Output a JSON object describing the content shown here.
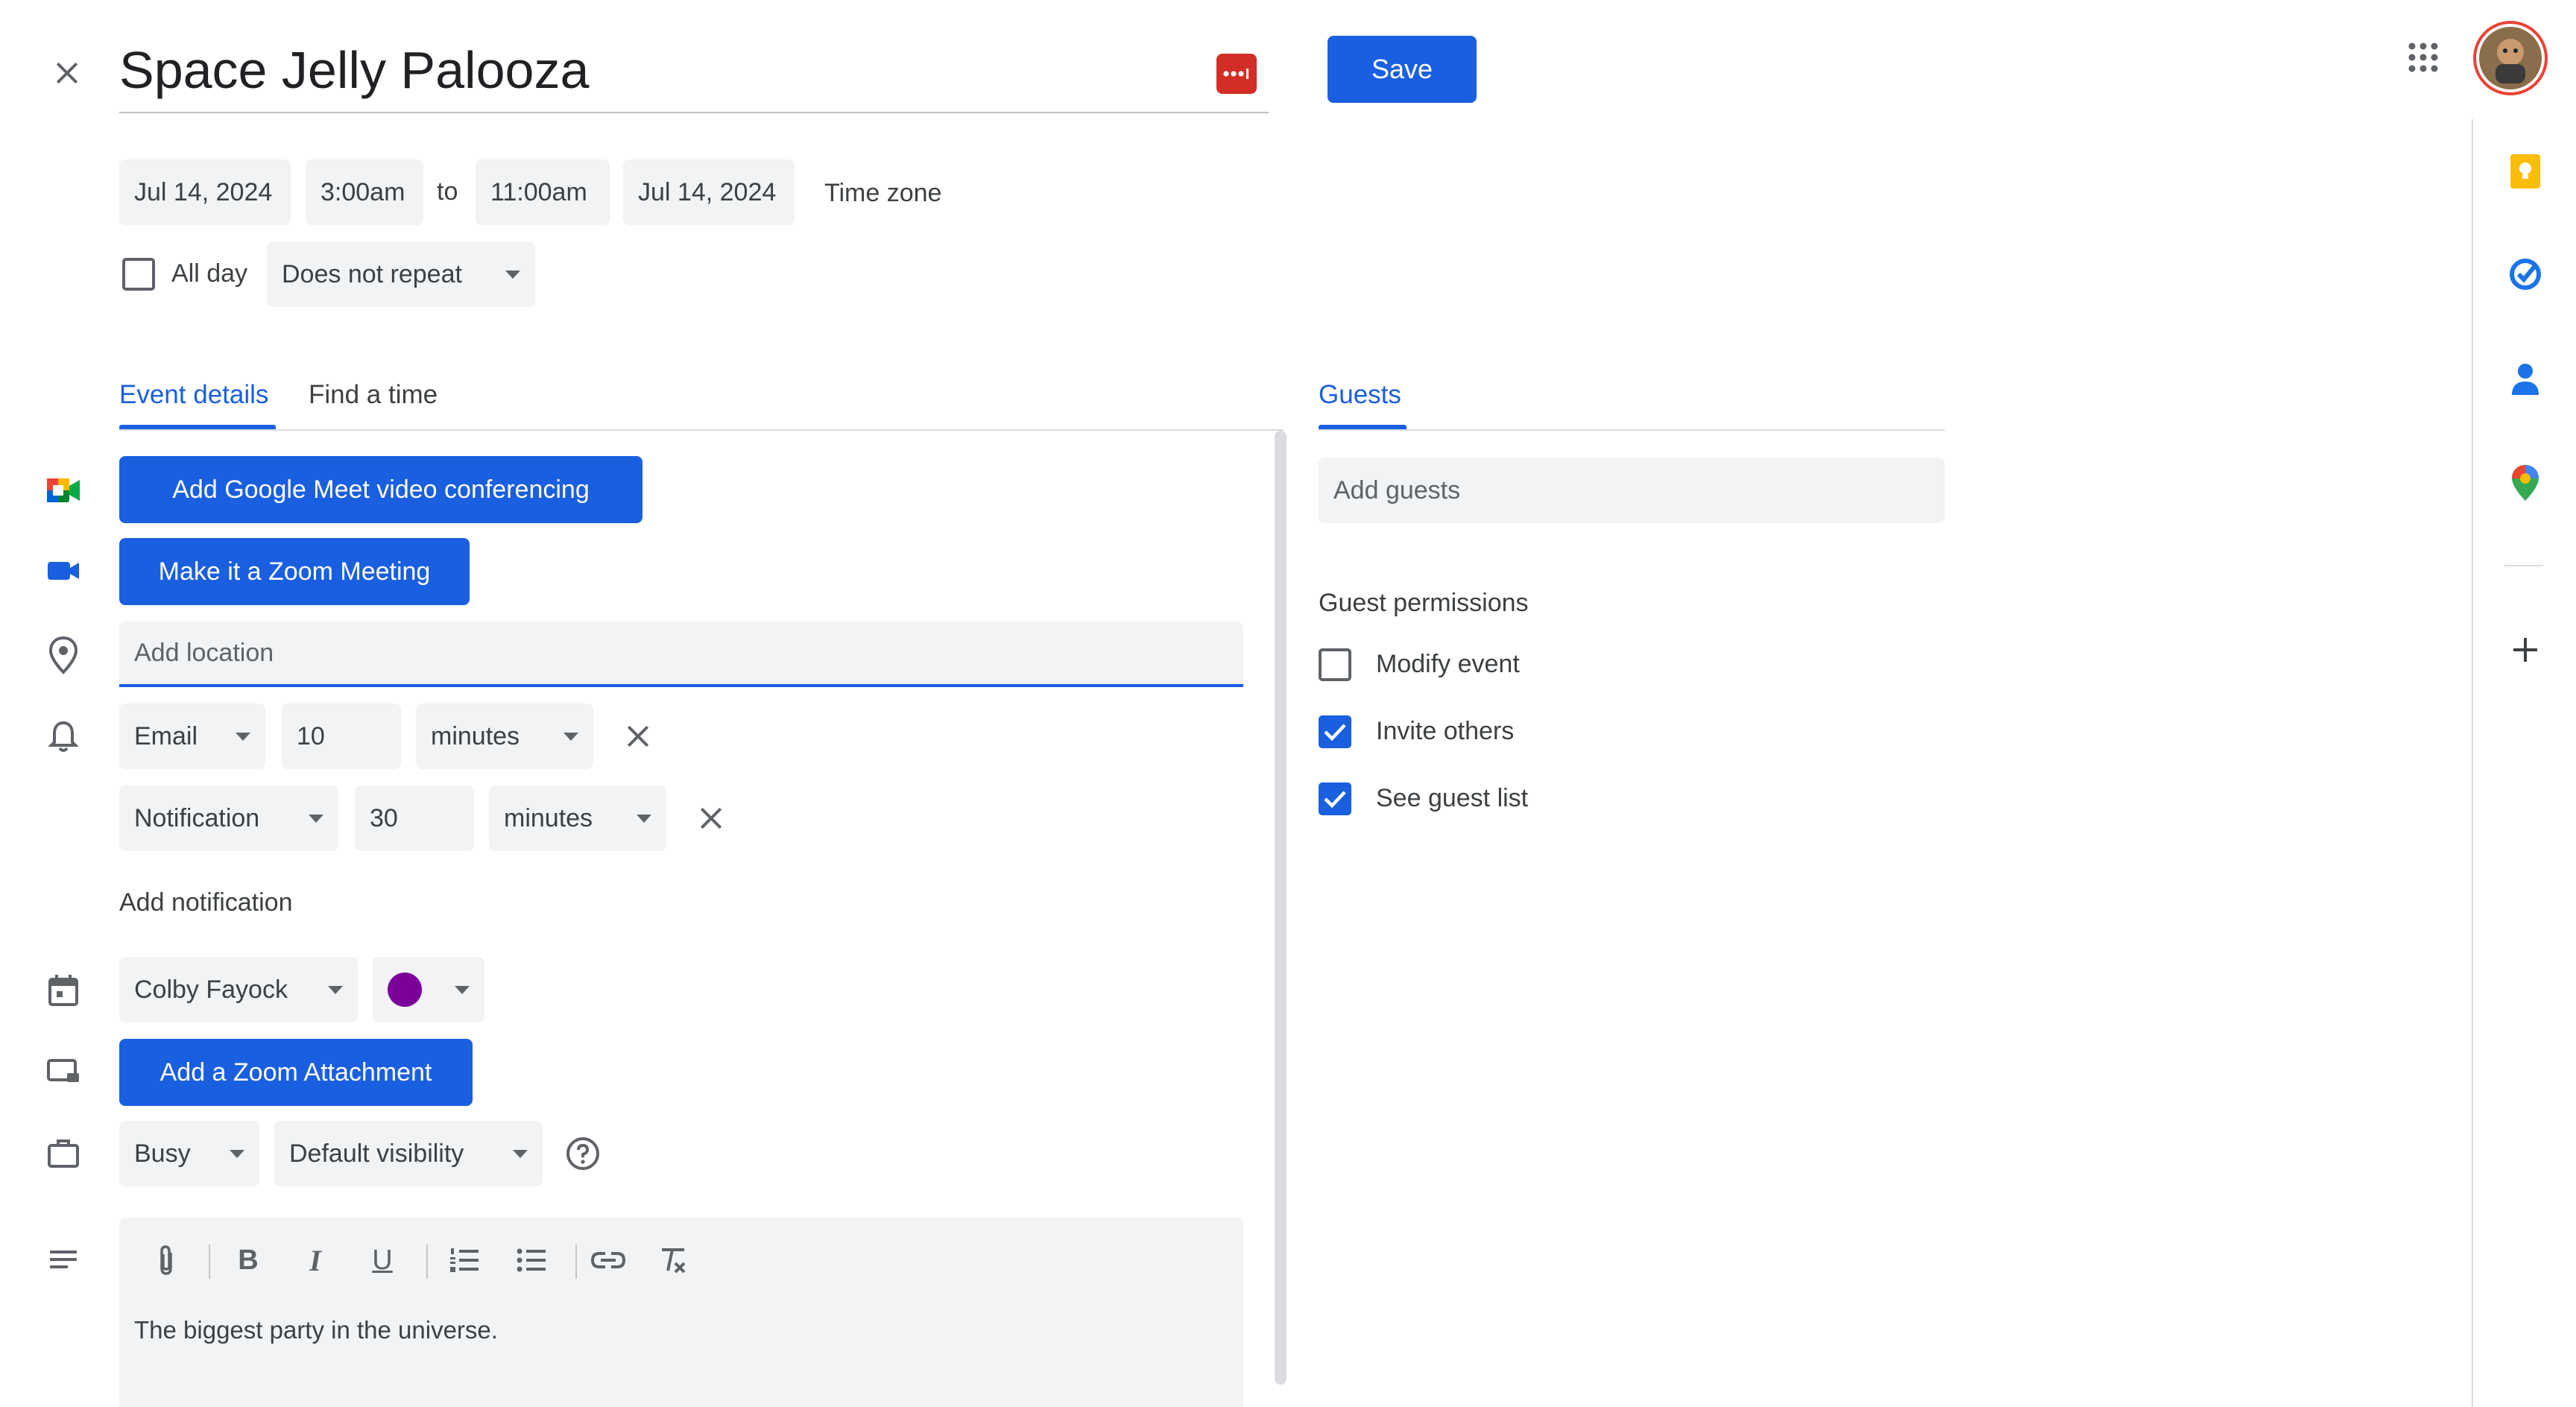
{
  "header": {
    "title": "Space Jelly Palooza",
    "save_label": "Save"
  },
  "datetime": {
    "start_date": "Jul 14, 2024",
    "start_time": "3:00am",
    "to_label": "to",
    "end_time": "11:00am",
    "end_date": "Jul 14, 2024",
    "timezone_label": "Time zone",
    "all_day_label": "All day",
    "repeat_value": "Does not repeat"
  },
  "tabs": {
    "event_details": "Event details",
    "find_time": "Find a time",
    "guests": "Guests"
  },
  "details": {
    "meet_button": "Add Google Meet video conferencing",
    "zoom_button": "Make it a Zoom Meeting",
    "location_placeholder": "Add location",
    "notifications": [
      {
        "type": "Email",
        "amount": "10",
        "unit": "minutes"
      },
      {
        "type": "Notification",
        "amount": "30",
        "unit": "minutes"
      }
    ],
    "add_notification": "Add notification",
    "calendar_owner": "Colby Fayock",
    "event_color": "#7b0099",
    "zoom_attachment_button": "Add a Zoom Attachment",
    "busy_value": "Busy",
    "visibility_value": "Default visibility",
    "description": "The biggest party in the universe."
  },
  "guests": {
    "add_placeholder": "Add guests",
    "permissions_title": "Guest permissions",
    "permissions": [
      {
        "label": "Modify event",
        "checked": false
      },
      {
        "label": "Invite others",
        "checked": true
      },
      {
        "label": "See guest list",
        "checked": true
      }
    ]
  },
  "colors": {
    "accent": "#1a5fe0",
    "field_bg": "#f1f3f4"
  }
}
